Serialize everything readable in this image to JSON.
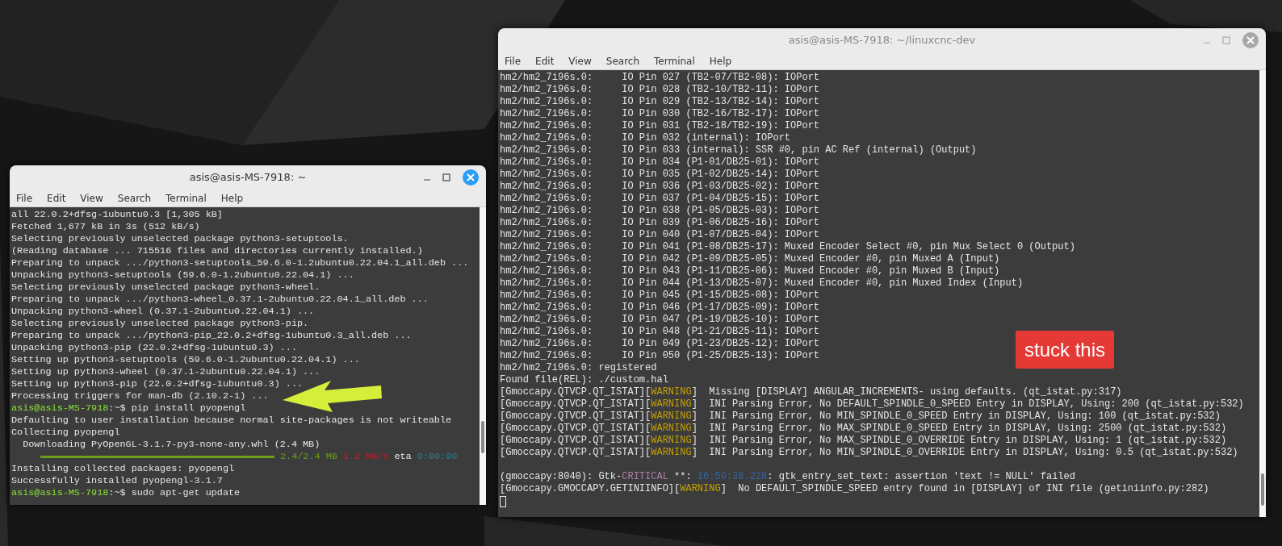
{
  "windows": [
    {
      "title": "asis@asis-MS-7918: ~",
      "active": true,
      "menu": [
        "File",
        "Edit",
        "View",
        "Search",
        "Terminal",
        "Help"
      ],
      "lines": [
        {
          "kind": "text",
          "segments": [
            {
              "text": "all 22.0.2+dfsg-1ubuntu0.3 [1,305 kB]"
            }
          ]
        },
        {
          "kind": "text",
          "segments": [
            {
              "text": "Fetched 1,677 kB in 3s (512 kB/s)"
            }
          ]
        },
        {
          "kind": "text",
          "segments": [
            {
              "text": "Selecting previously unselected package python3-setuptools."
            }
          ]
        },
        {
          "kind": "text",
          "segments": [
            {
              "text": "(Reading database ... 715516 files and directories currently installed.)"
            }
          ]
        },
        {
          "kind": "text",
          "segments": [
            {
              "text": "Preparing to unpack .../python3-setuptools_59.6.0-1.2ubuntu0.22.04.1_all.deb ..."
            }
          ]
        },
        {
          "kind": "text",
          "segments": [
            {
              "text": "Unpacking python3-setuptools (59.6.0-1.2ubuntu0.22.04.1) ..."
            }
          ]
        },
        {
          "kind": "text",
          "segments": [
            {
              "text": "Selecting previously unselected package python3-wheel."
            }
          ]
        },
        {
          "kind": "text",
          "segments": [
            {
              "text": "Preparing to unpack .../python3-wheel_0.37.1-2ubuntu0.22.04.1_all.deb ..."
            }
          ]
        },
        {
          "kind": "text",
          "segments": [
            {
              "text": "Unpacking python3-wheel (0.37.1-2ubuntu0.22.04.1) ..."
            }
          ]
        },
        {
          "kind": "text",
          "segments": [
            {
              "text": "Selecting previously unselected package python3-pip."
            }
          ]
        },
        {
          "kind": "text",
          "segments": [
            {
              "text": "Preparing to unpack .../python3-pip_22.0.2+dfsg-1ubuntu0.3_all.deb ..."
            }
          ]
        },
        {
          "kind": "text",
          "segments": [
            {
              "text": "Unpacking python3-pip (22.0.2+dfsg-1ubuntu0.3) ..."
            }
          ]
        },
        {
          "kind": "text",
          "segments": [
            {
              "text": "Setting up python3-setuptools (59.6.0-1.2ubuntu0.22.04.1) ..."
            }
          ]
        },
        {
          "kind": "text",
          "segments": [
            {
              "text": "Setting up python3-wheel (0.37.1-2ubuntu0.22.04.1) ..."
            }
          ]
        },
        {
          "kind": "text",
          "segments": [
            {
              "text": "Setting up python3-pip (22.0.2+dfsg-1ubuntu0.3) ..."
            }
          ]
        },
        {
          "kind": "text",
          "segments": [
            {
              "text": "Processing triggers for man-db (2.10.2-1) ..."
            }
          ]
        },
        {
          "kind": "text",
          "segments": [
            {
              "text": "asis@asis-MS-7918",
              "color": "#8ae234"
            },
            {
              "text": ":~$ pip install pyopengl"
            }
          ]
        },
        {
          "kind": "text",
          "segments": [
            {
              "text": "Defaulting to user installation because normal site-packages is not writeable"
            }
          ]
        },
        {
          "kind": "text",
          "segments": [
            {
              "text": "Collecting pyopengl"
            }
          ]
        },
        {
          "kind": "text",
          "segments": [
            {
              "text": "  Downloading PyOpenGL-3.1.7-py3-none-any.whl (2.4 MB)"
            }
          ]
        },
        {
          "kind": "progress",
          "level": 1,
          "segments": [
            {
              "text": "2.4/2.4 MB",
              "color": "#6c9c1a"
            },
            {
              "text": "3.2 MB/s",
              "color": "#c01c28"
            },
            {
              "text": "eta"
            },
            {
              "text": "0:00:00",
              "color": "#2a7f8f"
            }
          ]
        },
        {
          "kind": "text",
          "segments": [
            {
              "text": "Installing collected packages: pyopengl"
            }
          ]
        },
        {
          "kind": "text",
          "segments": [
            {
              "text": "Successfully installed pyopengl-3.1.7"
            }
          ]
        },
        {
          "kind": "text",
          "segments": [
            {
              "text": "asis@asis-MS-7918",
              "color": "#8ae234"
            },
            {
              "text": ":~$ sudo apt-get update"
            }
          ]
        }
      ]
    },
    {
      "title": "asis@asis-MS-7918: ~/linuxcnc-dev",
      "active": false,
      "menu": [
        "File",
        "Edit",
        "View",
        "Search",
        "Terminal",
        "Help"
      ],
      "lines": [
        {
          "kind": "text",
          "segments": [
            {
              "text": "hm2/hm2_7i96s.0:     IO Pin 027 (TB2-07/TB2-08): IOPort"
            }
          ]
        },
        {
          "kind": "text",
          "segments": [
            {
              "text": "hm2/hm2_7i96s.0:     IO Pin 028 (TB2-10/TB2-11): IOPort"
            }
          ]
        },
        {
          "kind": "text",
          "segments": [
            {
              "text": "hm2/hm2_7i96s.0:     IO Pin 029 (TB2-13/TB2-14): IOPort"
            }
          ]
        },
        {
          "kind": "text",
          "segments": [
            {
              "text": "hm2/hm2_7i96s.0:     IO Pin 030 (TB2-16/TB2-17): IOPort"
            }
          ]
        },
        {
          "kind": "text",
          "segments": [
            {
              "text": "hm2/hm2_7i96s.0:     IO Pin 031 (TB2-18/TB2-19): IOPort"
            }
          ]
        },
        {
          "kind": "text",
          "segments": [
            {
              "text": "hm2/hm2_7i96s.0:     IO Pin 032 (internal): IOPort"
            }
          ]
        },
        {
          "kind": "text",
          "segments": [
            {
              "text": "hm2/hm2_7i96s.0:     IO Pin 033 (internal): SSR #0, pin AC Ref (internal) (Output)"
            }
          ]
        },
        {
          "kind": "text",
          "segments": [
            {
              "text": "hm2/hm2_7i96s.0:     IO Pin 034 (P1-01/DB25-01): IOPort"
            }
          ]
        },
        {
          "kind": "text",
          "segments": [
            {
              "text": "hm2/hm2_7i96s.0:     IO Pin 035 (P1-02/DB25-14): IOPort"
            }
          ]
        },
        {
          "kind": "text",
          "segments": [
            {
              "text": "hm2/hm2_7i96s.0:     IO Pin 036 (P1-03/DB25-02): IOPort"
            }
          ]
        },
        {
          "kind": "text",
          "segments": [
            {
              "text": "hm2/hm2_7i96s.0:     IO Pin 037 (P1-04/DB25-15): IOPort"
            }
          ]
        },
        {
          "kind": "text",
          "segments": [
            {
              "text": "hm2/hm2_7i96s.0:     IO Pin 038 (P1-05/DB25-03): IOPort"
            }
          ]
        },
        {
          "kind": "text",
          "segments": [
            {
              "text": "hm2/hm2_7i96s.0:     IO Pin 039 (P1-06/DB25-16): IOPort"
            }
          ]
        },
        {
          "kind": "text",
          "segments": [
            {
              "text": "hm2/hm2_7i96s.0:     IO Pin 040 (P1-07/DB25-04): IOPort"
            }
          ]
        },
        {
          "kind": "text",
          "segments": [
            {
              "text": "hm2/hm2_7i96s.0:     IO Pin 041 (P1-08/DB25-17): Muxed Encoder Select #0, pin Mux Select 0 (Output)"
            }
          ]
        },
        {
          "kind": "text",
          "segments": [
            {
              "text": "hm2/hm2_7i96s.0:     IO Pin 042 (P1-09/DB25-05): Muxed Encoder #0, pin Muxed A (Input)"
            }
          ]
        },
        {
          "kind": "text",
          "segments": [
            {
              "text": "hm2/hm2_7i96s.0:     IO Pin 043 (P1-11/DB25-06): Muxed Encoder #0, pin Muxed B (Input)"
            }
          ]
        },
        {
          "kind": "text",
          "segments": [
            {
              "text": "hm2/hm2_7i96s.0:     IO Pin 044 (P1-13/DB25-07): Muxed Encoder #0, pin Muxed Index (Input)"
            }
          ]
        },
        {
          "kind": "text",
          "segments": [
            {
              "text": "hm2/hm2_7i96s.0:     IO Pin 045 (P1-15/DB25-08): IOPort"
            }
          ]
        },
        {
          "kind": "text",
          "segments": [
            {
              "text": "hm2/hm2_7i96s.0:     IO Pin 046 (P1-17/DB25-09): IOPort"
            }
          ]
        },
        {
          "kind": "text",
          "segments": [
            {
              "text": "hm2/hm2_7i96s.0:     IO Pin 047 (P1-19/DB25-10): IOPort"
            }
          ]
        },
        {
          "kind": "text",
          "segments": [
            {
              "text": "hm2/hm2_7i96s.0:     IO Pin 048 (P1-21/DB25-11): IOPort"
            }
          ]
        },
        {
          "kind": "text",
          "segments": [
            {
              "text": "hm2/hm2_7i96s.0:     IO Pin 049 (P1-23/DB25-12): IOPort"
            }
          ]
        },
        {
          "kind": "text",
          "segments": [
            {
              "text": "hm2/hm2_7i96s.0:     IO Pin 050 (P1-25/DB25-13): IOPort"
            }
          ]
        },
        {
          "kind": "text",
          "segments": [
            {
              "text": "hm2/hm2_7i96s.0: registered"
            }
          ]
        },
        {
          "kind": "text",
          "segments": [
            {
              "text": "Found file(REL): ./custom.hal"
            }
          ]
        },
        {
          "kind": "text",
          "segments": [
            {
              "text": "[Gmoccapy.QTVCP.QT_ISTAT]["
            },
            {
              "text": "WARNING",
              "color": "#c4a000"
            },
            {
              "text": "]  Missing [DISPLAY] ANGULAR_INCREMENTS- using defaults. (qt_istat.py:317)"
            }
          ]
        },
        {
          "kind": "text",
          "segments": [
            {
              "text": "[Gmoccapy.QTVCP.QT_ISTAT]["
            },
            {
              "text": "WARNING",
              "color": "#c4a000"
            },
            {
              "text": "]  INI Parsing Error, No DEFAULT_SPINDLE_0_SPEED Entry in DISPLAY, Using: 200 (qt_istat.py:532)"
            }
          ]
        },
        {
          "kind": "text",
          "segments": [
            {
              "text": "[Gmoccapy.QTVCP.QT_ISTAT]["
            },
            {
              "text": "WARNING",
              "color": "#c4a000"
            },
            {
              "text": "]  INI Parsing Error, No MIN_SPINDLE_0_SPEED Entry in DISPLAY, Using: 100 (qt_istat.py:532)"
            }
          ]
        },
        {
          "kind": "text",
          "segments": [
            {
              "text": "[Gmoccapy.QTVCP.QT_ISTAT]["
            },
            {
              "text": "WARNING",
              "color": "#c4a000"
            },
            {
              "text": "]  INI Parsing Error, No MAX_SPINDLE_0_SPEED Entry in DISPLAY, Using: 2500 (qt_istat.py:532)"
            }
          ]
        },
        {
          "kind": "text",
          "segments": [
            {
              "text": "[Gmoccapy.QTVCP.QT_ISTAT]["
            },
            {
              "text": "WARNING",
              "color": "#c4a000"
            },
            {
              "text": "]  INI Parsing Error, No MAX_SPINDLE_0_OVERRIDE Entry in DISPLAY, Using: 1 (qt_istat.py:532)"
            }
          ]
        },
        {
          "kind": "text",
          "segments": [
            {
              "text": "[Gmoccapy.QTVCP.QT_ISTAT]["
            },
            {
              "text": "WARNING",
              "color": "#c4a000"
            },
            {
              "text": "]  INI Parsing Error, No MIN_SPINDLE_0_OVERRIDE Entry in DISPLAY, Using: 0.5 (qt_istat.py:532)"
            }
          ]
        },
        {
          "kind": "blank"
        },
        {
          "kind": "text",
          "segments": [
            {
              "text": "(gmoccapy:8040): Gtk-"
            },
            {
              "text": "CRITICAL",
              "color": "#ad7fa8"
            },
            {
              "text": " **: "
            },
            {
              "text": "16:50:36.228",
              "color": "#3465a4"
            },
            {
              "text": ": gtk_entry_set_text: assertion 'text != NULL' failed"
            }
          ]
        },
        {
          "kind": "text",
          "segments": [
            {
              "text": "[Gmoccapy.GMOCCAPY.GETINIINFO]["
            },
            {
              "text": "WARNING",
              "color": "#c4a000"
            },
            {
              "text": "]  No DEFAULT_SPINDLE_SPEED entry found in [DISPLAY] of INI file (getiniinfo.py:282)"
            }
          ]
        },
        {
          "kind": "cursor"
        }
      ]
    }
  ],
  "annotation": {
    "text": "stuck this"
  }
}
